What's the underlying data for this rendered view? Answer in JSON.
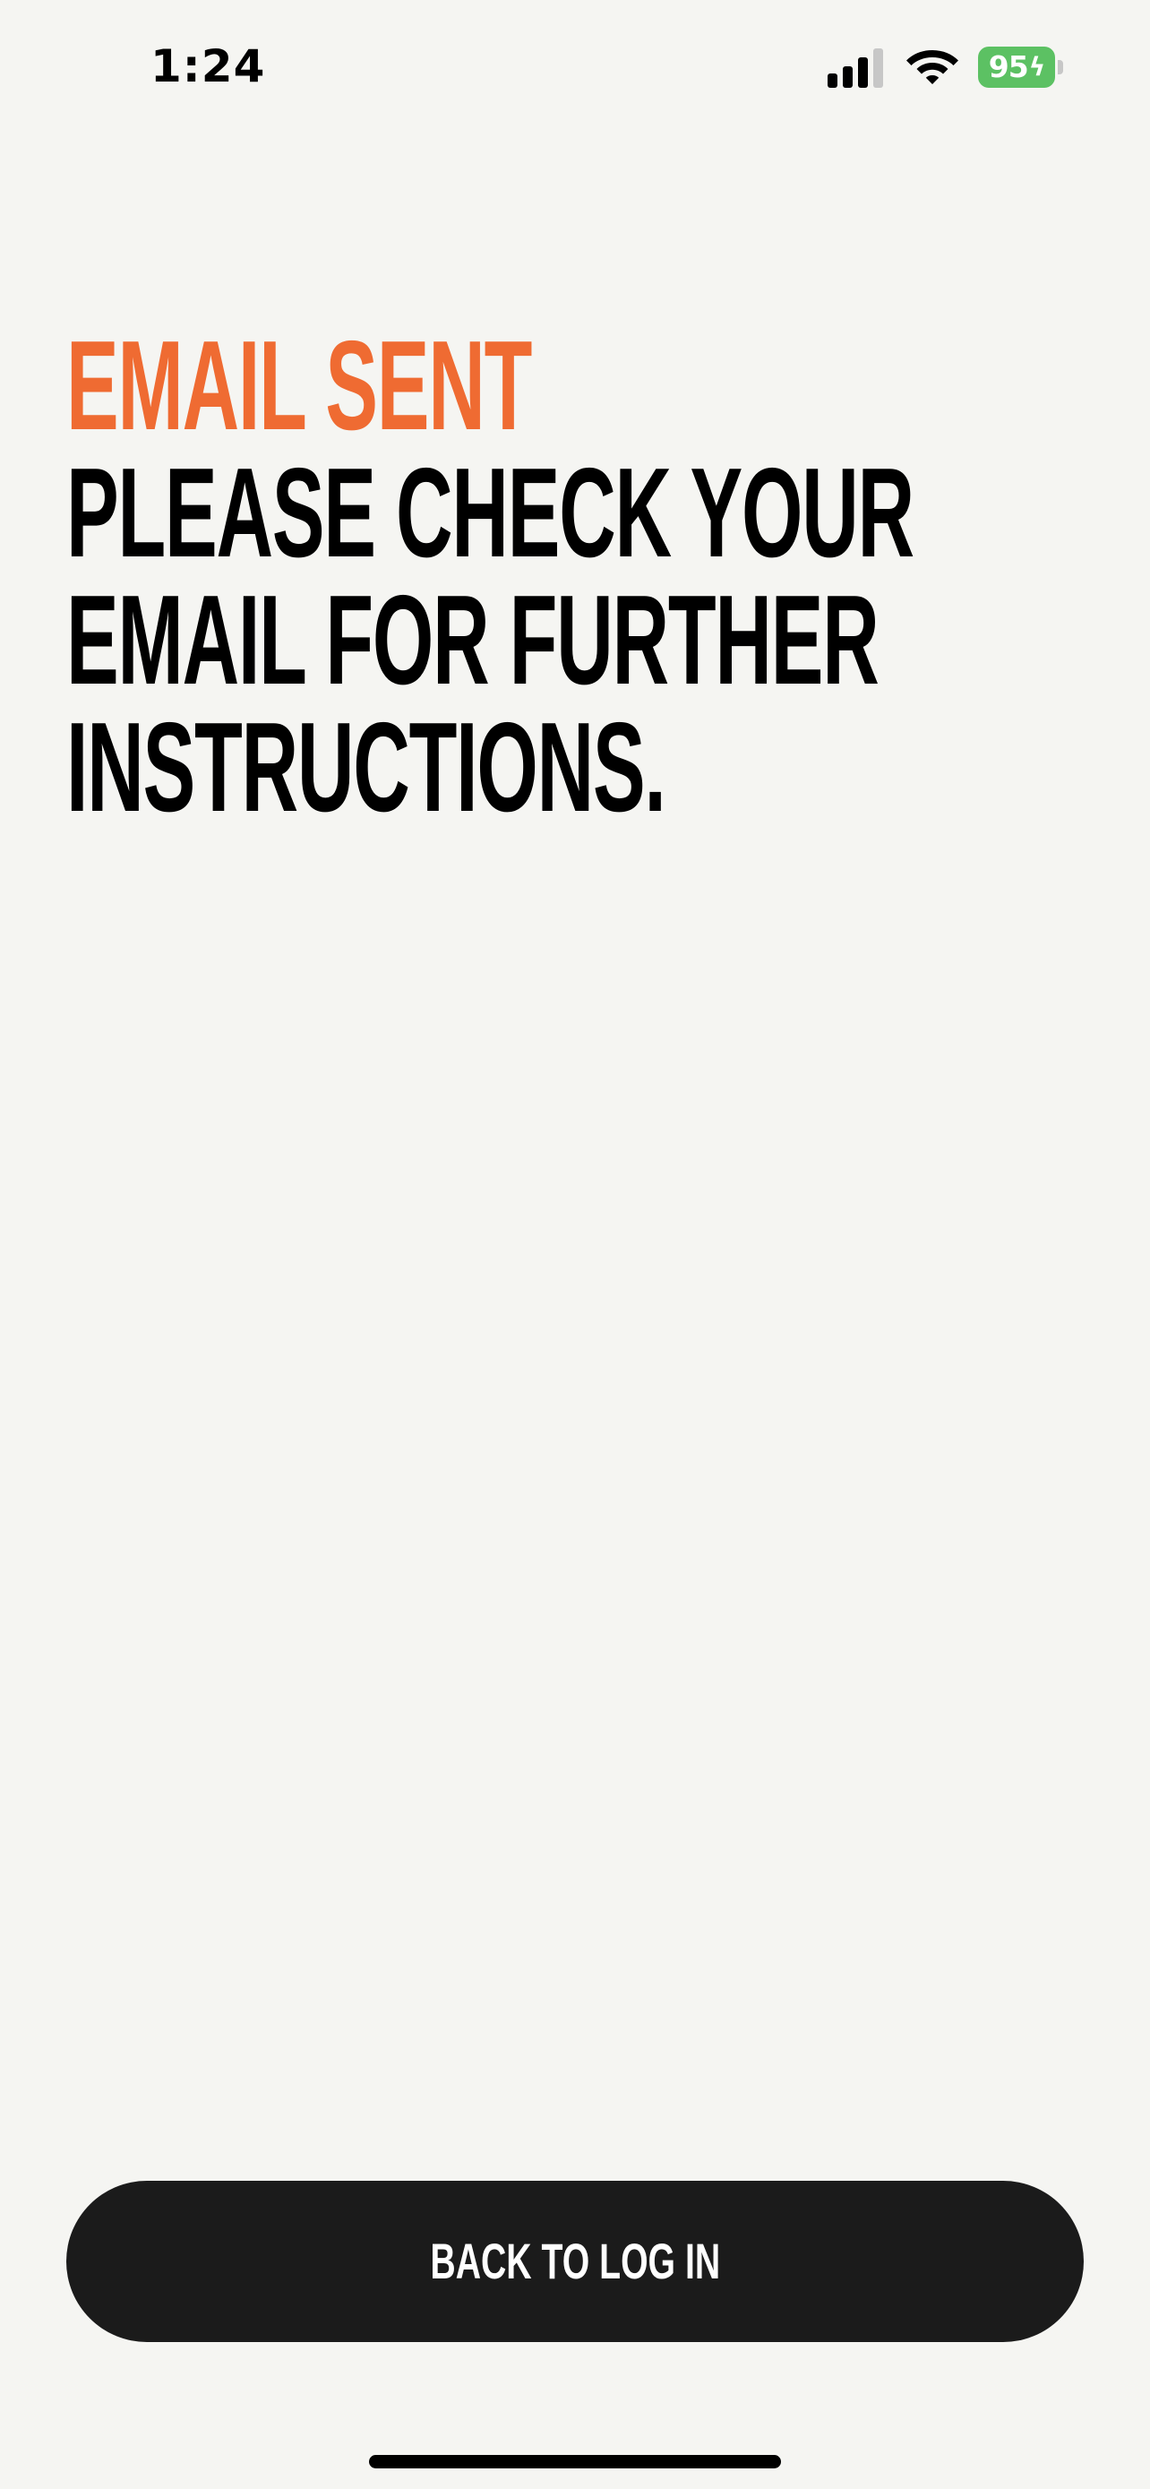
{
  "status_bar": {
    "time": "1:24",
    "battery_level": "95",
    "battery_charging": true,
    "signal_bars_active": 3,
    "signal_bars_total": 4,
    "signal_icon": "cellular-signal-icon",
    "wifi_icon": "wifi-icon",
    "battery_icon": "battery-charging-icon"
  },
  "headline": {
    "accent": "EMAIL SENT",
    "body": "PLEASE CHECK YOUR\nEMAIL FOR FURTHER\nINSTRUCTIONS."
  },
  "actions": {
    "back_label": "BACK TO LOG IN"
  },
  "colors": {
    "background": "#f5f5f2",
    "accent": "#ef6b32",
    "text": "#000000",
    "button_bg": "#1b1b1b",
    "button_text": "#ffffff",
    "battery_green": "#5cc163"
  }
}
